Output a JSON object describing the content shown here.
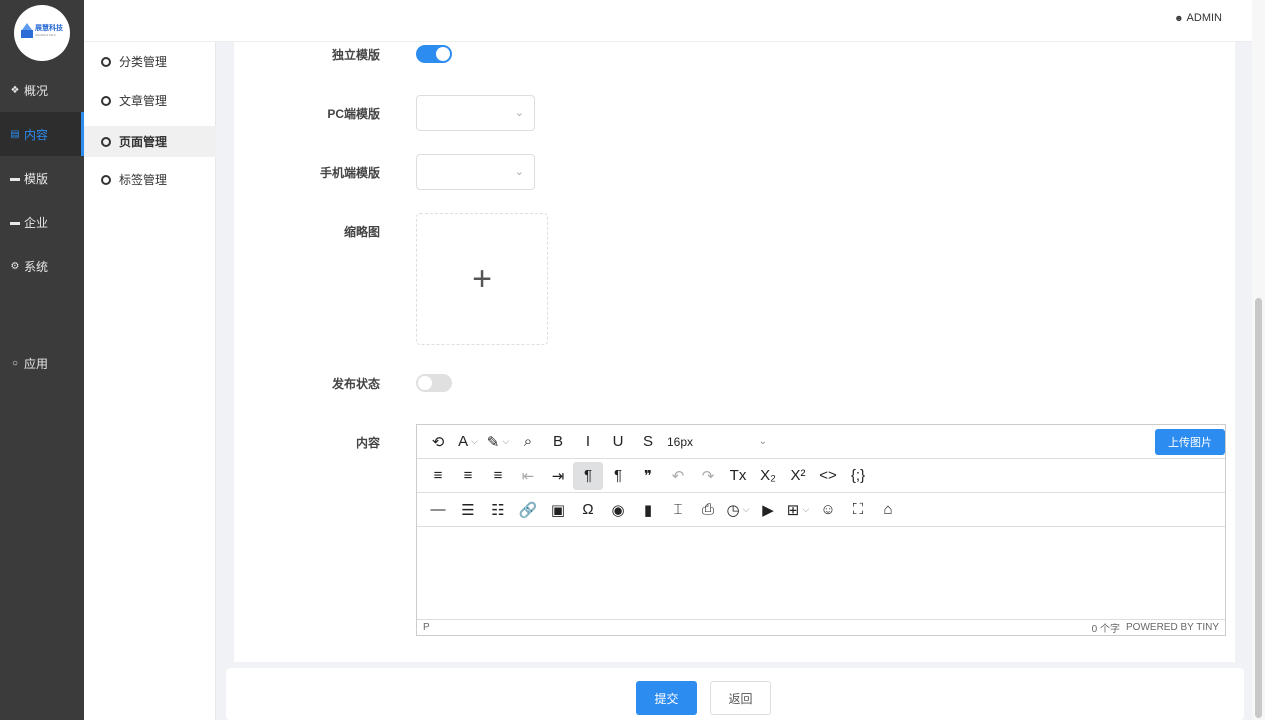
{
  "brand": {
    "logo_text": "展慧科技",
    "logo_sub": "ZHANHUI KEJI"
  },
  "header": {
    "user_icon": "user-icon",
    "user_name": "ADMIN"
  },
  "sidebar": {
    "items": [
      {
        "icon": "dashboard-icon",
        "glyph": "❖",
        "label": "概况"
      },
      {
        "icon": "document-icon",
        "glyph": "▤",
        "label": "内容"
      },
      {
        "icon": "template-icon",
        "glyph": "▬",
        "label": "模版"
      },
      {
        "icon": "company-icon",
        "glyph": "▬",
        "label": "企业"
      },
      {
        "icon": "settings-icon",
        "glyph": "⚙",
        "label": "系统"
      },
      {
        "icon": "circle-icon",
        "glyph": "○",
        "label": "应用"
      }
    ],
    "active": "内容"
  },
  "submenu": {
    "items": [
      {
        "label": "分类管理"
      },
      {
        "label": "文章管理"
      },
      {
        "label": "页面管理"
      },
      {
        "label": "标签管理"
      }
    ],
    "active": "页面管理"
  },
  "form": {
    "standalone_template": {
      "label": "独立模版",
      "value": true
    },
    "pc_template": {
      "label": "PC端模版",
      "value": ""
    },
    "mobile_template": {
      "label": "手机端模版",
      "value": ""
    },
    "thumbnail": {
      "label": "缩略图",
      "glyph": "+"
    },
    "publish_status": {
      "label": "发布状态",
      "value": false
    },
    "content": {
      "label": "内容"
    }
  },
  "editor": {
    "font_size": "16px",
    "upload_image_label": "上传图片",
    "status_path": "P",
    "word_count": "0 个字",
    "powered_by": "POWERED BY TINY",
    "toolbar_row1": [
      {
        "name": "history-icon",
        "glyph": "⟲"
      },
      {
        "name": "text-color-icon",
        "glyph": "A",
        "dropdown": true
      },
      {
        "name": "highlight-icon",
        "glyph": "✎",
        "dropdown": true
      },
      {
        "name": "search-icon",
        "glyph": "⌕"
      },
      {
        "name": "bold-icon",
        "glyph": "B"
      },
      {
        "name": "italic-icon",
        "glyph": "I"
      },
      {
        "name": "underline-icon",
        "glyph": "U"
      },
      {
        "name": "strikethrough-icon",
        "glyph": "S"
      }
    ],
    "toolbar_row2": [
      {
        "name": "align-left-icon",
        "glyph": "≡"
      },
      {
        "name": "align-center-icon",
        "glyph": "≡"
      },
      {
        "name": "align-right-icon",
        "glyph": "≡"
      },
      {
        "name": "outdent-icon",
        "glyph": "⇤",
        "dim": true
      },
      {
        "name": "indent-icon",
        "glyph": "⇥"
      },
      {
        "name": "ltr-icon",
        "glyph": "¶",
        "selected": true
      },
      {
        "name": "rtl-icon",
        "glyph": "¶"
      },
      {
        "name": "blockquote-icon",
        "glyph": "❞"
      },
      {
        "name": "undo-icon",
        "glyph": "↶",
        "dim": true
      },
      {
        "name": "redo-icon",
        "glyph": "↷",
        "dim": true
      },
      {
        "name": "clear-format-icon",
        "glyph": "Tx"
      },
      {
        "name": "subscript-icon",
        "glyph": "X₂"
      },
      {
        "name": "superscript-icon",
        "glyph": "X²"
      },
      {
        "name": "code-icon",
        "glyph": "<>"
      },
      {
        "name": "code-sample-icon",
        "glyph": "{;}"
      }
    ],
    "toolbar_row3": [
      {
        "name": "horizontal-rule-icon",
        "glyph": "—"
      },
      {
        "name": "bullet-list-icon",
        "glyph": "☰"
      },
      {
        "name": "numbered-list-icon",
        "glyph": "☷"
      },
      {
        "name": "link-icon",
        "glyph": "🔗"
      },
      {
        "name": "image-icon",
        "glyph": "▣"
      },
      {
        "name": "special-char-icon",
        "glyph": "Ω"
      },
      {
        "name": "preview-icon",
        "glyph": "◉"
      },
      {
        "name": "bookmark-icon",
        "glyph": "▮"
      },
      {
        "name": "page-break-icon",
        "glyph": "⌶"
      },
      {
        "name": "print-icon",
        "glyph": "⎙"
      },
      {
        "name": "datetime-icon",
        "glyph": "◷",
        "dropdown": true
      },
      {
        "name": "media-icon",
        "glyph": "▶"
      },
      {
        "name": "table-icon",
        "glyph": "⊞",
        "dropdown": true
      },
      {
        "name": "emoji-icon",
        "glyph": "☺"
      },
      {
        "name": "fullscreen-icon",
        "glyph": "⛶"
      },
      {
        "name": "format-painter-icon",
        "glyph": "⌂"
      }
    ]
  },
  "footer": {
    "submit_label": "提交",
    "back_label": "返回"
  },
  "colors": {
    "accent": "#2d8cf0",
    "sidebar_bg": "#3b3b3b"
  }
}
